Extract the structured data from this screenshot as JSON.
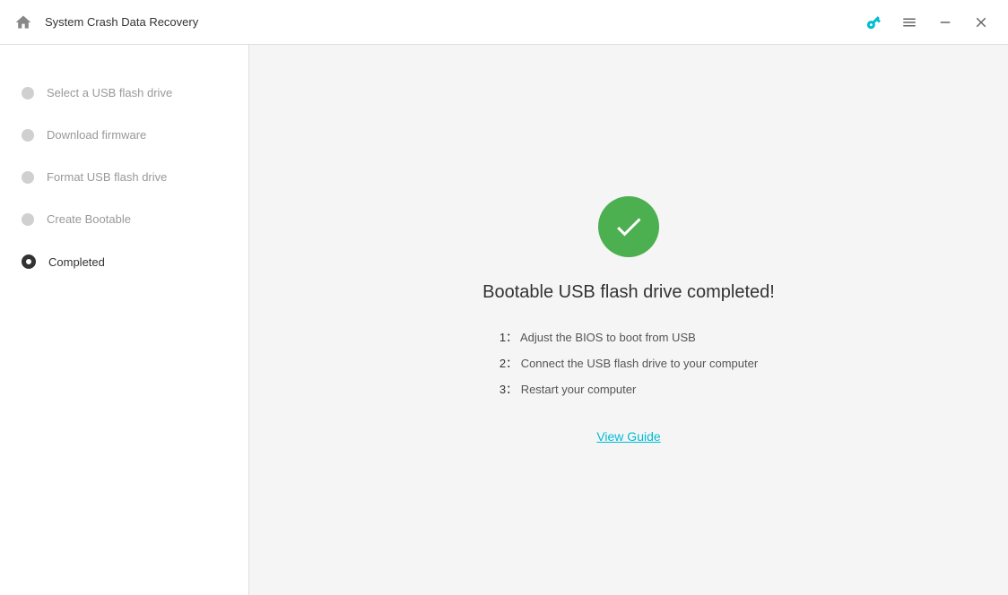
{
  "titlebar": {
    "title": "System Crash Data Recovery",
    "home_icon": "🏠",
    "key_icon": "🔑",
    "menu_icon": "≡",
    "minimize_icon": "—",
    "close_icon": "✕"
  },
  "sidebar": {
    "items": [
      {
        "label": "Select a USB flash drive",
        "active": false
      },
      {
        "label": "Download firmware",
        "active": false
      },
      {
        "label": "Format USB flash drive",
        "active": false
      },
      {
        "label": "Create Bootable",
        "active": false
      },
      {
        "label": "Completed",
        "active": true
      }
    ]
  },
  "main": {
    "completion_title": "Bootable USB flash drive completed!",
    "instructions": [
      {
        "num": "1：",
        "text": " Adjust the BIOS to boot from USB"
      },
      {
        "num": "2：",
        "text": " Connect the USB flash drive to your computer"
      },
      {
        "num": "3：",
        "text": " Restart your computer"
      }
    ],
    "view_guide_label": "View Guide"
  }
}
